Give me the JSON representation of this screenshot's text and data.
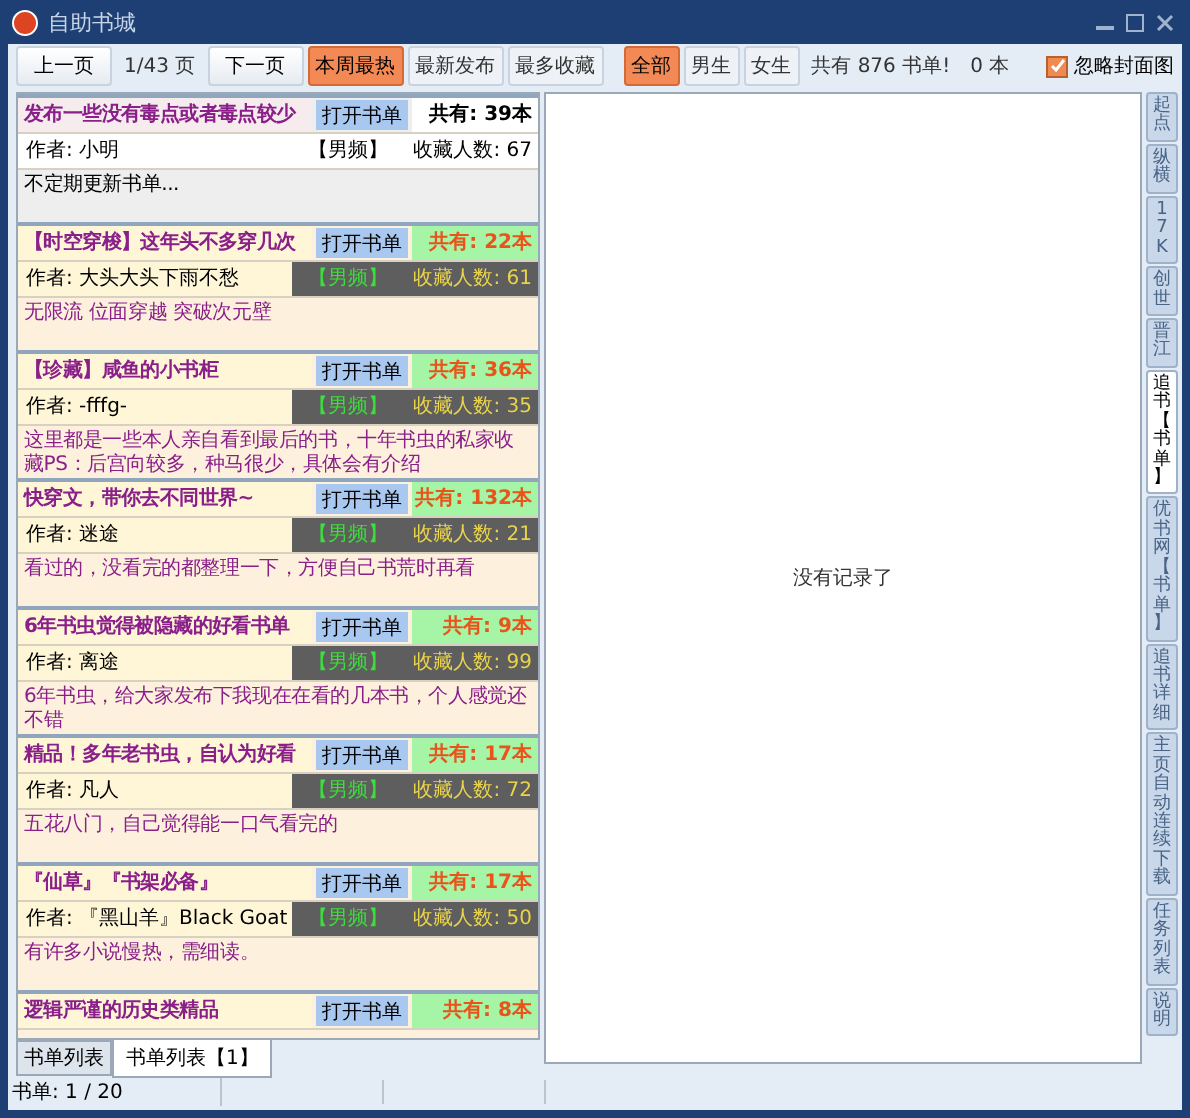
{
  "window": {
    "title": "自助书城"
  },
  "toolbar": {
    "prev": "上一页",
    "page": "1/43 页",
    "next": "下一页",
    "sort_tabs": [
      {
        "label": "本周最热",
        "selected": true
      },
      {
        "label": "最新发布",
        "selected": false
      },
      {
        "label": "最多收藏",
        "selected": false
      }
    ],
    "filter_tabs": [
      {
        "label": "全部",
        "selected": true
      },
      {
        "label": "男生",
        "selected": false
      },
      {
        "label": "女生",
        "selected": false
      }
    ],
    "summary": "共有 876 书单!",
    "count": "0 本",
    "ignore_cover": {
      "label": "忽略封面图",
      "checked": true
    }
  },
  "lists": [
    {
      "title": "发布一些没有毒点或者毒点较少",
      "open": "打开书单",
      "total": "共有: 39本",
      "author": "作者: 小明",
      "channel": "【男频】",
      "collects": "收藏人数: 67",
      "description": "不定期更新书单...",
      "selected": true
    },
    {
      "title": "【时空穿梭】这年头不多穿几次",
      "open": "打开书单",
      "total": "共有: 22本",
      "author": "作者: 大头大头下雨不愁",
      "channel": "【男频】",
      "collects": "收藏人数: 61",
      "description": "无限流 位面穿越 突破次元壁",
      "selected": false
    },
    {
      "title": "【珍藏】咸鱼的小书柜",
      "open": "打开书单",
      "total": "共有: 36本",
      "author": "作者: -fffg-",
      "channel": "【男频】",
      "collects": "收藏人数: 35",
      "description": "这里都是一些本人亲自看到最后的书，十年书虫的私家收藏PS：后宫向较多，种马很少，具体会有介绍",
      "selected": false
    },
    {
      "title": "快穿文，带你去不同世界~",
      "open": "打开书单",
      "total": "共有: 132本",
      "author": "作者: 迷途",
      "channel": "【男频】",
      "collects": "收藏人数: 21",
      "description": "看过的，没看完的都整理一下，方便自己书荒时再看",
      "selected": false
    },
    {
      "title": "6年书虫觉得被隐藏的好看书单",
      "open": "打开书单",
      "total": "共有: 9本",
      "author": "作者: 离途",
      "channel": "【男频】",
      "collects": "收藏人数: 99",
      "description": "6年书虫，给大家发布下我现在在看的几本书，个人感觉还不错",
      "selected": false
    },
    {
      "title": "精品！多年老书虫，自认为好看",
      "open": "打开书单",
      "total": "共有: 17本",
      "author": "作者: 凡人",
      "channel": "【男频】",
      "collects": "收藏人数: 72",
      "description": "五花八门，自己觉得能一口气看完的",
      "selected": false
    },
    {
      "title": "『仙草』『书架必备』",
      "open": "打开书单",
      "total": "共有: 17本",
      "author": "作者: 『黑山羊』Black Goat",
      "channel": "【男频】",
      "collects": "收藏人数: 50",
      "description": "有许多小说慢热，需细读。",
      "selected": false
    },
    {
      "title": "逻辑严谨的历史类精品",
      "open": "打开书单",
      "total": "共有: 8本",
      "selected": false
    }
  ],
  "detail": {
    "empty": "没有记录了"
  },
  "side_tabs": [
    {
      "label": "起点",
      "selected": false
    },
    {
      "label": "纵横",
      "selected": false
    },
    {
      "label": "17K",
      "selected": false
    },
    {
      "label": "创世",
      "selected": false
    },
    {
      "label": "晋江",
      "selected": false
    },
    {
      "label": "追书【书单】",
      "selected": true
    },
    {
      "label": "优书网【书单】",
      "selected": false
    },
    {
      "label": "追书详细",
      "selected": false
    },
    {
      "label": "主页自动连续下载",
      "selected": false
    },
    {
      "label": "任务列表",
      "selected": false
    },
    {
      "label": "说明",
      "selected": false
    }
  ],
  "bottom_tabs": [
    {
      "label": "书单列表",
      "selected": false
    },
    {
      "label": "书单列表【1】",
      "selected": true
    }
  ],
  "status_bar": {
    "text": "书单: 1 / 20"
  }
}
